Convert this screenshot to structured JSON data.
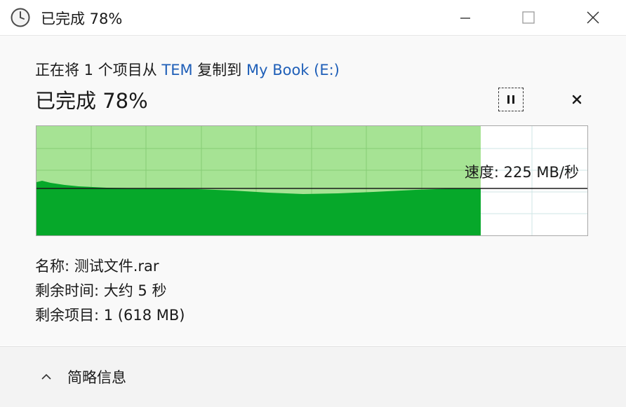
{
  "window": {
    "title": "已完成 78%",
    "title_icon": "clock-icon"
  },
  "window_controls": {
    "minimize_icon": "minimize-icon",
    "maximize_icon": "maximize-icon",
    "close_icon": "close-icon"
  },
  "copy": {
    "prefix": "正在将 1 个项目从 ",
    "source": "TEM",
    "middle": " 复制到 ",
    "destination": "My Book (E:)",
    "percent_heading": "已完成 78%",
    "progress_fraction": 0.78,
    "speed_text": "速度: 225 MB/秒",
    "pause_icon": "pause-icon",
    "cancel_icon": "cancel-icon"
  },
  "details": {
    "name": "名称: 测试文件.rar",
    "time_remaining": "剩余时间: 大约 5 秒",
    "items_remaining": "剩余项目: 1 (618 MB)"
  },
  "footer": {
    "toggle_label": "简略信息",
    "toggle_icon": "chevron-up-icon"
  },
  "colors": {
    "graph_light_green": "#a6e394",
    "graph_dark_green": "#06a82a",
    "grid_line": "#7fc46f",
    "link_blue": "#1f5fb8"
  }
}
